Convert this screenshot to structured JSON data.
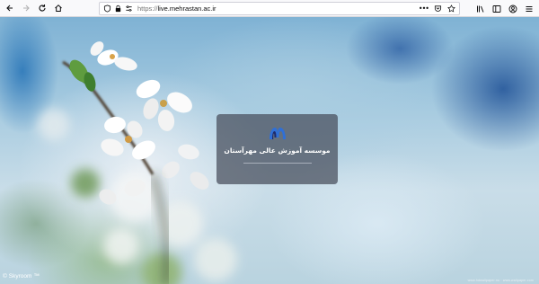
{
  "browser": {
    "url_scheme": "https://",
    "url_host": "live.mehrastan.ac.ir",
    "icons": [
      "back-arrow-icon",
      "forward-arrow-icon",
      "reload-icon",
      "home-icon",
      "shield-icon",
      "lock-icon",
      "permissions-icon",
      "page-actions-icon",
      "pocket-icon",
      "bookmark-star-icon",
      "library-icon",
      "sidebar-icon",
      "account-icon",
      "menu-icon"
    ]
  },
  "page": {
    "card_title": "موسسه آموزش عالی مهرآستان",
    "watermark": "Skyroom",
    "watermark_tm": "™",
    "corner_text": "www.hdwallpaper.nu · www.wallpaper.com"
  },
  "colors": {
    "card_bg": "#464c5a",
    "logo_blue": "#2f6fd6",
    "logo_dark": "#1b2a6e"
  }
}
